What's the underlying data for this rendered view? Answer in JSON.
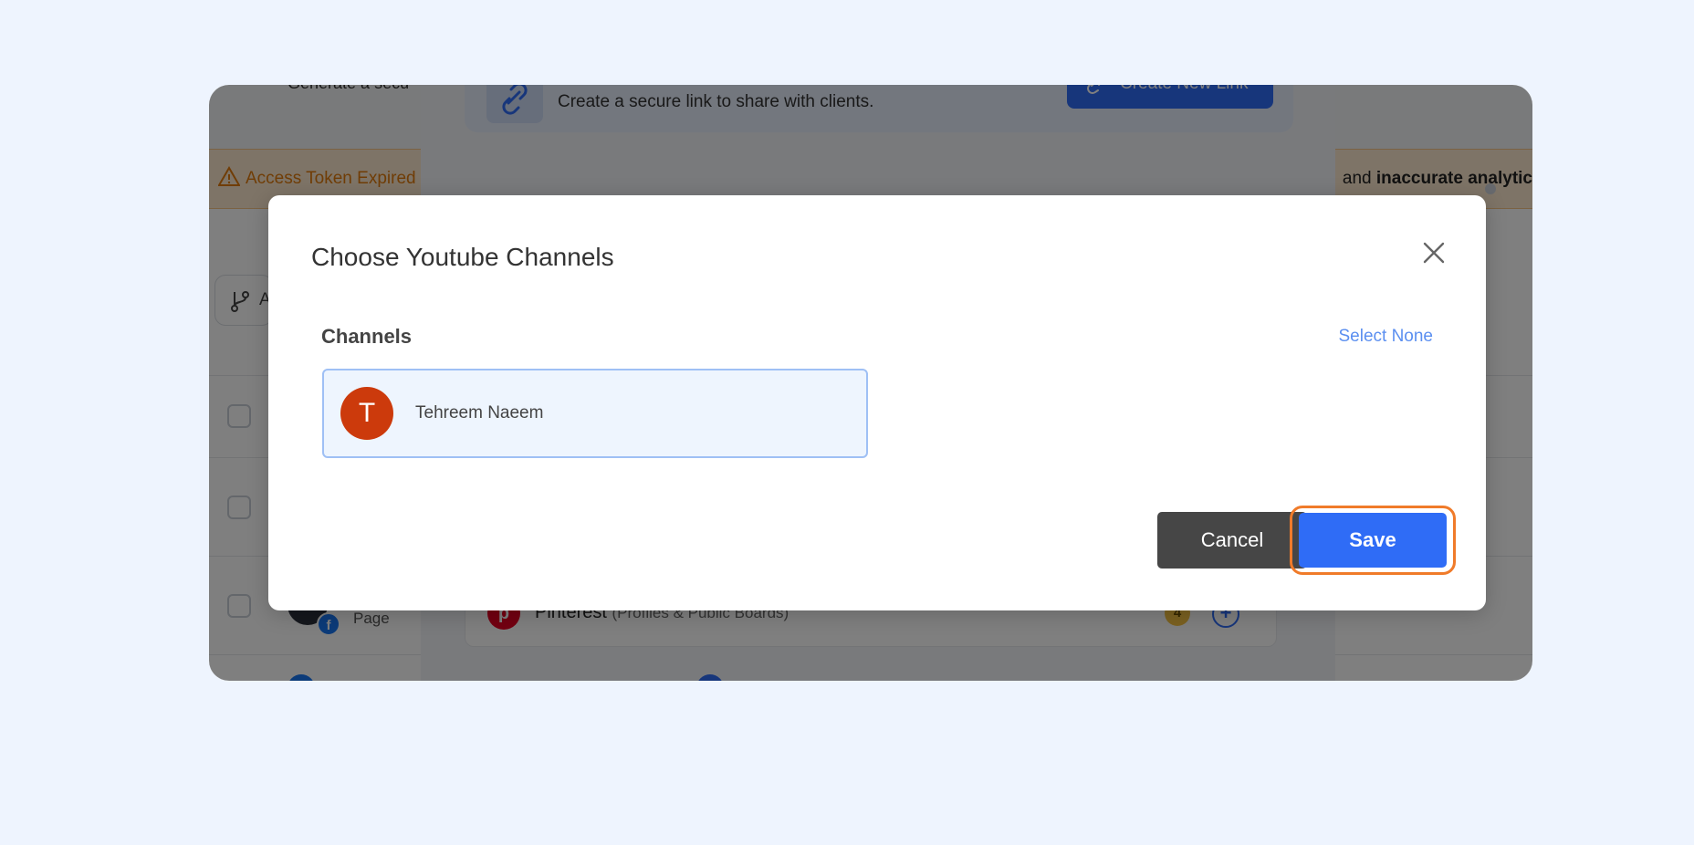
{
  "background_app": {
    "header_partial_text": "Generate a secu",
    "alert": {
      "left_text": "Access Token Expired",
      "right_prefix": "and",
      "right_bold": "inaccurate analytic"
    },
    "filter_chip_text": "A",
    "row_page_label": "Page",
    "facebook_badge": "f",
    "link_card": {
      "description": "Create a secure link to share with clients.",
      "create_button": "Create New Link"
    },
    "platform": {
      "icon_letter": "p",
      "name": "Pinterest",
      "subtitle": "(Profiles & Public Boards)",
      "count": "4",
      "add_symbol": "+"
    }
  },
  "modal": {
    "title": "Choose Youtube Channels",
    "section_title": "Channels",
    "select_none": "Select None",
    "channels": [
      {
        "initial": "T",
        "name": "Tehreem Naeem"
      }
    ],
    "cancel_label": "Cancel",
    "save_label": "Save"
  },
  "colors": {
    "page_background": "#eef4fe",
    "primary": "#2f6cf6",
    "cancel": "#464646",
    "highlight_ring": "#f07b2a",
    "avatar": "#cc3a0c",
    "link": "#5b8ff0"
  }
}
